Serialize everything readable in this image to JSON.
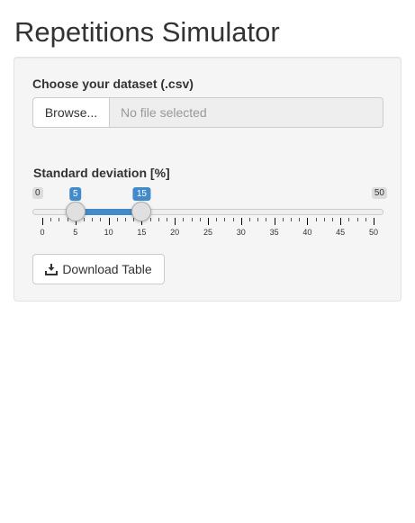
{
  "page": {
    "title": "Repetitions Simulator"
  },
  "file_input": {
    "label": "Choose your dataset (.csv)",
    "browse_label": "Browse...",
    "status_text": "No file selected"
  },
  "slider": {
    "label": "Standard deviation [%]",
    "min": 0,
    "max": 50,
    "from": 5,
    "to": 15,
    "major_ticks": [
      0,
      5,
      10,
      15,
      20,
      25,
      30,
      35,
      40,
      45,
      50
    ],
    "accent_color": "#428bca"
  },
  "download": {
    "label": "Download Table",
    "icon": "download-icon"
  }
}
